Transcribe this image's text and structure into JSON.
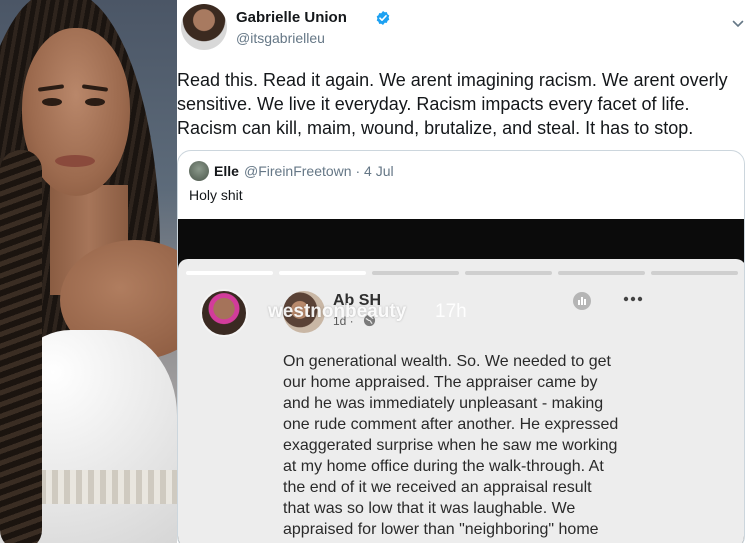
{
  "tweet": {
    "author_name": "Gabrielle Union",
    "author_handle": "@itsgabrielleu",
    "text": "Read this. Read it again. We arent imagining racism. We arent overly\nsensitive. We live it everyday. Racism impacts every facet of life.\nRacism can kill, maim, wound, brutalize, and steal. It has to stop.",
    "verified": true,
    "colors": {
      "verified_badge": "#1da1f2",
      "secondary_text": "#657786",
      "border": "#ccd6dd"
    }
  },
  "quoted_tweet": {
    "author_name": "Elle",
    "author_handle": "@FireinFreetown · 4 Jul",
    "text": "Holy shit"
  },
  "story": {
    "instagram_username": "westnonbeauty",
    "instagram_time": "17h",
    "fb_author": "Ab SH",
    "fb_time": "1d ·",
    "post_text": "On generational wealth. So. We needed to get\nour home appraised. The appraiser came by\nand he was immediately unpleasant - making\none rude comment after another. He expressed\nexaggerated surprise  when he saw me working\nat my home office during the walk-through. At\nthe end of it we received an appraisal result\nthat was so low that it was laughable. We\nappraised for lower than \"neighboring\" home",
    "progress_segments": [
      1,
      1,
      0,
      0,
      0,
      0
    ]
  },
  "icons": [
    "verified-badge-icon",
    "chevron-down-icon",
    "globe-icon",
    "insights-icon",
    "more-icon"
  ]
}
